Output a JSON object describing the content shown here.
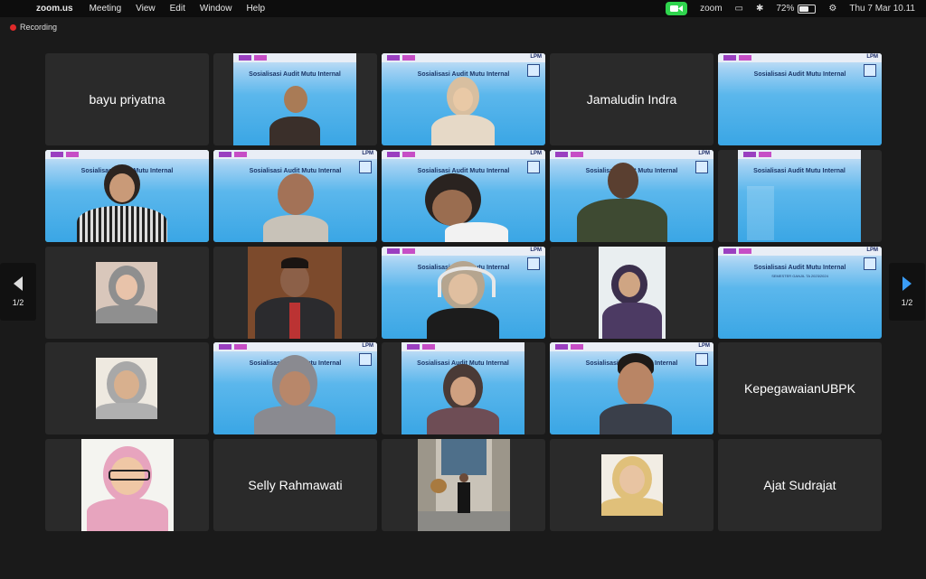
{
  "menubar": {
    "app_name": "zoom.us",
    "menus": [
      "Meeting",
      "View",
      "Edit",
      "Window",
      "Help"
    ],
    "status_zoom": "zoom",
    "battery": "72%",
    "battery_level": 0.72,
    "datetime": "Thu 7 Mar  10.11"
  },
  "recording": {
    "label": "Recording"
  },
  "slide": {
    "title": "Sosialisasi Audit Mutu Internal",
    "subtitle": "SEMESTER GANJIL TA 2023/2024",
    "brand": "LPM"
  },
  "participants": {
    "bayu": "bayu priyatna",
    "jamaludin": "Jamaludin Indra",
    "kepegawaian": "KepegawaianUBPK",
    "selly": "Selly Rahmawati",
    "ajat": "Ajat Sudrajat"
  },
  "nav": {
    "left_page": "1/2",
    "right_page": "1/2"
  },
  "colors": {
    "active_speaker": "#5ec84e",
    "recording_dot": "#e02a2a",
    "nav_arrow_right": "#3a9df7"
  }
}
